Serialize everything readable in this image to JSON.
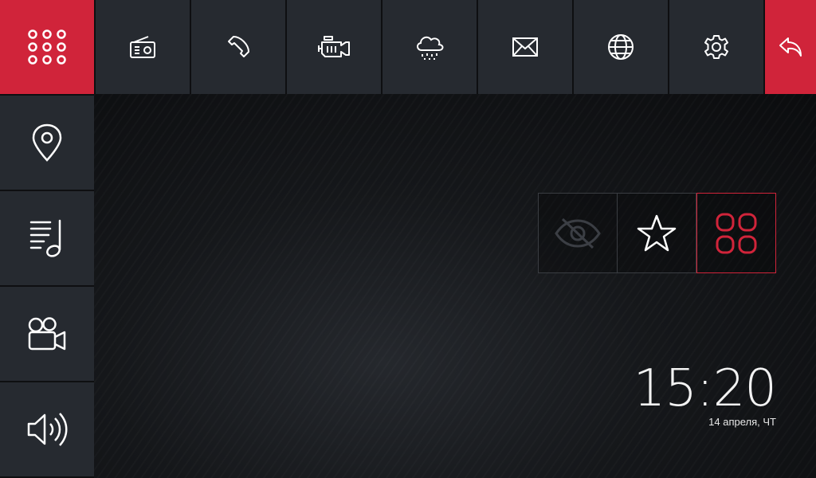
{
  "topbar": {
    "items": [
      {
        "icon": "grid-dots-icon",
        "active": true
      },
      {
        "icon": "radio-icon"
      },
      {
        "icon": "phone-icon"
      },
      {
        "icon": "engine-icon"
      },
      {
        "icon": "weather-cloud-rain-icon"
      },
      {
        "icon": "mail-icon"
      },
      {
        "icon": "globe-icon"
      },
      {
        "icon": "gear-icon"
      },
      {
        "icon": "back-arrow-icon",
        "accent": true
      }
    ]
  },
  "sidebar": {
    "items": [
      {
        "icon": "map-pin-icon"
      },
      {
        "icon": "music-list-icon"
      },
      {
        "icon": "video-camera-icon"
      },
      {
        "icon": "speaker-volume-icon"
      }
    ]
  },
  "widget": {
    "buttons": [
      {
        "icon": "eye-off-icon",
        "state": "disabled"
      },
      {
        "icon": "star-icon"
      },
      {
        "icon": "apps-grid-icon",
        "state": "selected"
      }
    ]
  },
  "clock": {
    "time": "15:20",
    "date": "14 апреля, ЧТ"
  },
  "colors": {
    "accent": "#d0243a",
    "tile": "#262a30",
    "background": "#0e0f11"
  }
}
